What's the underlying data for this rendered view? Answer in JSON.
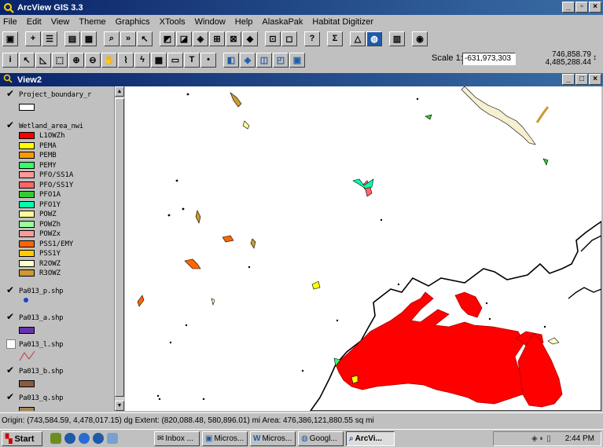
{
  "app": {
    "title": "ArcView GIS 3.3"
  },
  "menu": [
    "File",
    "Edit",
    "View",
    "Theme",
    "Graphics",
    "XTools",
    "Window",
    "Help",
    "AlaskaPak",
    "Habitat Digitizer"
  ],
  "toolbar": {
    "scale_label": "Scale 1:",
    "scale_value": "-631,973,303",
    "coord_x": "746,858.79",
    "coord_y": "4,485,288.44"
  },
  "view": {
    "title": "View2"
  },
  "toc": {
    "themes": [
      {
        "name": "Project_boundary_r",
        "checked": true
      },
      {
        "name": "Wetland_area_nwi",
        "checked": true
      },
      {
        "name": "Pa013_p.shp",
        "checked": true
      },
      {
        "name": "Pa013_a.shp",
        "checked": true
      },
      {
        "name": "Pa013_l.shp",
        "checked": false
      },
      {
        "name": "Pa013_b.shp",
        "checked": true
      },
      {
        "name": "Pa013_q.shp",
        "checked": true
      }
    ],
    "wetland_legend": [
      {
        "label": "L1OWZh",
        "color": "#ff0000"
      },
      {
        "label": "PEMA",
        "color": "#ffff00"
      },
      {
        "label": "PEMB",
        "color": "#ff9900"
      },
      {
        "label": "PEMY",
        "color": "#33ff66"
      },
      {
        "label": "PFO/SS1A",
        "color": "#ff9999"
      },
      {
        "label": "PFO/SS1Y",
        "color": "#ff6666"
      },
      {
        "label": "PFO1A",
        "color": "#33cc33"
      },
      {
        "label": "PFO1Y",
        "color": "#00ffaa"
      },
      {
        "label": "POWZ",
        "color": "#ffff99"
      },
      {
        "label": "POWZh",
        "color": "#99ff99"
      },
      {
        "label": "POWZx",
        "color": "#ff9999"
      },
      {
        "label": "PSS1/EMY",
        "color": "#ff6600"
      },
      {
        "label": "PSS1Y",
        "color": "#ffcc00"
      },
      {
        "label": "R2OWZ",
        "color": "#ffffcc"
      },
      {
        "label": "R3OWZ",
        "color": "#cc9933"
      }
    ]
  },
  "status": {
    "text": "Origin: (743,584.59, 4,478,017.15) dg  Extent: (820,088.48, 580,896.01) mi  Area: 476,386,121,880.55 sq mi"
  },
  "taskbar": {
    "start": "Start",
    "tasks": [
      "Inbox ...",
      "Micros...",
      "Micros...",
      "Googl...",
      "ArcVi..."
    ],
    "clock": "2:44 PM"
  }
}
